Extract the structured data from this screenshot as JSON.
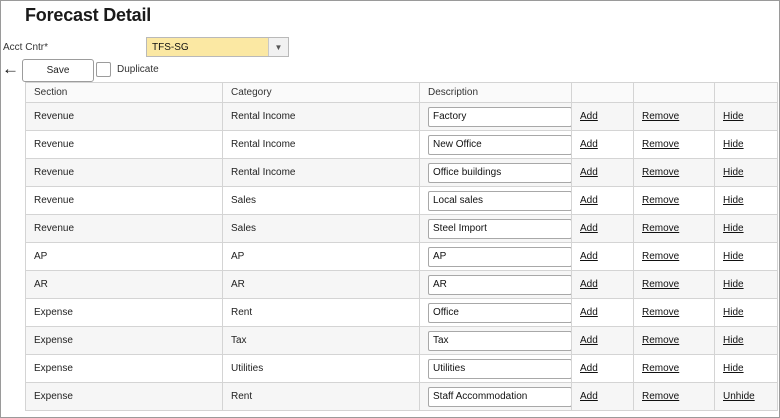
{
  "page": {
    "title": "Forecast Detail"
  },
  "account": {
    "label": "Acct Cntr*",
    "value": "TFS-SG"
  },
  "toolbar": {
    "back_glyph": "←",
    "save_label": "Save",
    "duplicate_label": "Duplicate"
  },
  "grid": {
    "columns": [
      "Section",
      "Category",
      "Description",
      "",
      "",
      ""
    ],
    "rows": [
      {
        "section": "Revenue",
        "category": "Rental Income",
        "description": "Factory",
        "add": "Add",
        "remove": "Remove",
        "hide": "Hide"
      },
      {
        "section": "Revenue",
        "category": "Rental Income",
        "description": "New Office",
        "add": "Add",
        "remove": "Remove",
        "hide": "Hide"
      },
      {
        "section": "Revenue",
        "category": "Rental Income",
        "description": "Office buildings",
        "add": "Add",
        "remove": "Remove",
        "hide": "Hide"
      },
      {
        "section": "Revenue",
        "category": "Sales",
        "description": "Local sales",
        "add": "Add",
        "remove": "Remove",
        "hide": "Hide"
      },
      {
        "section": "Revenue",
        "category": "Sales",
        "description": "Steel Import",
        "add": "Add",
        "remove": "Remove",
        "hide": "Hide"
      },
      {
        "section": "AP",
        "category": "AP",
        "description": "AP",
        "add": "Add",
        "remove": "Remove",
        "hide": "Hide"
      },
      {
        "section": "AR",
        "category": "AR",
        "description": "AR",
        "add": "Add",
        "remove": "Remove",
        "hide": "Hide"
      },
      {
        "section": "Expense",
        "category": "Rent",
        "description": "Office",
        "add": "Add",
        "remove": "Remove",
        "hide": "Hide"
      },
      {
        "section": "Expense",
        "category": "Tax",
        "description": "Tax",
        "add": "Add",
        "remove": "Remove",
        "hide": "Hide"
      },
      {
        "section": "Expense",
        "category": "Utilities",
        "description": "Utilities",
        "add": "Add",
        "remove": "Remove",
        "hide": "Hide"
      },
      {
        "section": "Expense",
        "category": "Rent",
        "description": "Staff Accommodation",
        "add": "Add",
        "remove": "Remove",
        "hide": "Unhide"
      }
    ]
  }
}
